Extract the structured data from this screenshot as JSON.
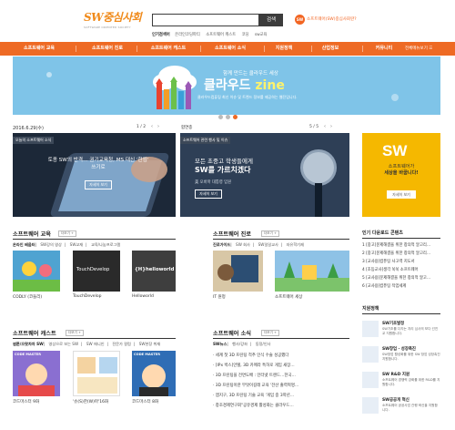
{
  "header": {
    "logo_text": "SW중심사회",
    "logo_sub": "SOFTWARE ORIENTED SOCIETY",
    "search_placeholder": "",
    "search_button": "검색",
    "sw_badge": "SW",
    "sw_promo": "소프트웨어(SW)중심사회란?",
    "popular_label": "인기검색어",
    "popular_terms": [
      "온라인코딩파티",
      "소프트웨어 캐스트",
      "코딩",
      "sw교육"
    ]
  },
  "nav": {
    "items": [
      "소프트웨어 교육",
      "소프트웨어 진로",
      "소프트웨어 캐스트",
      "소프트웨어 소식",
      "지원정책",
      "산업정보",
      "커뮤니티"
    ],
    "all_menu": "전체메뉴보기 ☰"
  },
  "banner": {
    "title": "함께 만드는 클라우드 세상",
    "main": "클라우드",
    "main_accent": "zine",
    "subtitle": "클라우드컴퓨팅 최신 이슈 및 트렌드 정보를 제공하는 웹진입니다."
  },
  "slider": {
    "date": "2016.6.29(수)",
    "page": "1 / 2",
    "card1": {
      "tag": "오늘의 소프트웨어 소식",
      "title_lines": [
        "토종 SW의 반격… 권기교육청, MS 대신 '한컴'",
        "쓰기로"
      ],
      "button": "자세히 보기"
    }
  },
  "hapmyeong": {
    "label": "합연종",
    "page": "5 / 5",
    "card2": {
      "tag": "소프트웨어 관련 행사 및 이슈",
      "title_lines": [
        "모든 초중고 학생들에게",
        "SW를 가르치겠다"
      ],
      "subtitle": "美 오바마 대통령 입원",
      "button": "자세히 보기"
    }
  },
  "ad": {
    "badge": "SW",
    "lines": [
      "소프트웨어가",
      "세상을 바꿉니다!"
    ],
    "button": "자세히 보기"
  },
  "edu": {
    "title": "소프트웨어 교육",
    "more": "더보기 +",
    "tabs": [
      "온라인 배움터",
      "SW강의 영상",
      "SW교재",
      "교육/나눔프로그램",
      "SW교육"
    ],
    "thumbs": [
      {
        "caption": "CODLY (코들리)"
      },
      {
        "caption": "TouchDevelop",
        "thumb_text": "TouchDevelop"
      },
      {
        "caption": "Helloworld",
        "thumb_text": "{H}helloworld"
      }
    ]
  },
  "career": {
    "title": "소프트웨어 진로",
    "more": "더보기 +",
    "tabs": [
      "진로가이드",
      "SW 회사",
      "SW일일교사",
      "자유학기제"
    ],
    "thumbs": [
      {
        "caption": "IT 원정"
      },
      {
        "caption": "소프트웨어 세상"
      }
    ]
  },
  "cast": {
    "title": "소프트웨어 캐스트",
    "more": "더보기 +",
    "tabs": [
      "썸툰/으랏차차 SW",
      "영상으로 보는 SW",
      "SW 애니인",
      "전문가 칼럼",
      "SW현장 취재"
    ],
    "thumbs": [
      {
        "caption": "코드마스터 9화",
        "thumb_text": "CODE MASTER"
      },
      {
        "caption": "'슈(S)한(W)마'16화",
        "thumb_text": ""
      },
      {
        "caption": "코드마스터 8화",
        "thumb_text": "CODE MASTER"
      }
    ]
  },
  "news": {
    "title": "소프트웨어 소식",
    "more": "더보기 +",
    "tabs": [
      "SW뉴스",
      "행사/강좌",
      "동정/인사"
    ],
    "items": [
      "· 세계 첫 3D 프린팅 척추 인식 수술 성공했다",
      "· [IPx 박스]인텔, 3D 카메라 특허로 게임 새장…",
      "· 3D 프린팅을 전면도배 : 인터넷 트렌드…한국…",
      "· 3D 프린팅이란 무엇이길래 교육 '전산 출력혁명…",
      "· 앱지구, 3D 프린팅 기술 교육 '게임 중 3학년…",
      "· 창조경제연구회\"공유경제 활성화는 클라우드…"
    ]
  },
  "sidebar": {
    "popular_title": "인기 다운로드 콘텐츠",
    "popular_items": [
      "1 [중고]문제해결을 위한 창의적 알고리…",
      "2 [중고]문제해결을 위한 창의적 알고리…",
      "3 [교사용]컴퓨팅 사고력 지도서",
      "4 [초등교사]생각 쑥쑥 소프트웨어",
      "5 [교사용]문제해결을 위한 창의적 알고…",
      "6 [교사용]컴퓨팅 작업세계"
    ],
    "policy_title": "지원정책",
    "policy_items": [
      {
        "title": "SW기초발정",
        "desc": "SW기초를 다지는 지리 심사의 보다 선진교 지원합니다."
      },
      {
        "title": "SW창업 · 성장촉진",
        "desc": "SW창업 활성화를 위한 SW 창업 성장촉진 지원합니다."
      },
      {
        "title": "SW R&D 지원",
        "desc": "소프트웨어 경쟁력 강화를 위한 R&D를 지원합니다."
      },
      {
        "title": "SW공공개 혁신",
        "desc": "소프트웨어 공공사업 관행 혁신을 지원합니다."
      }
    ]
  }
}
